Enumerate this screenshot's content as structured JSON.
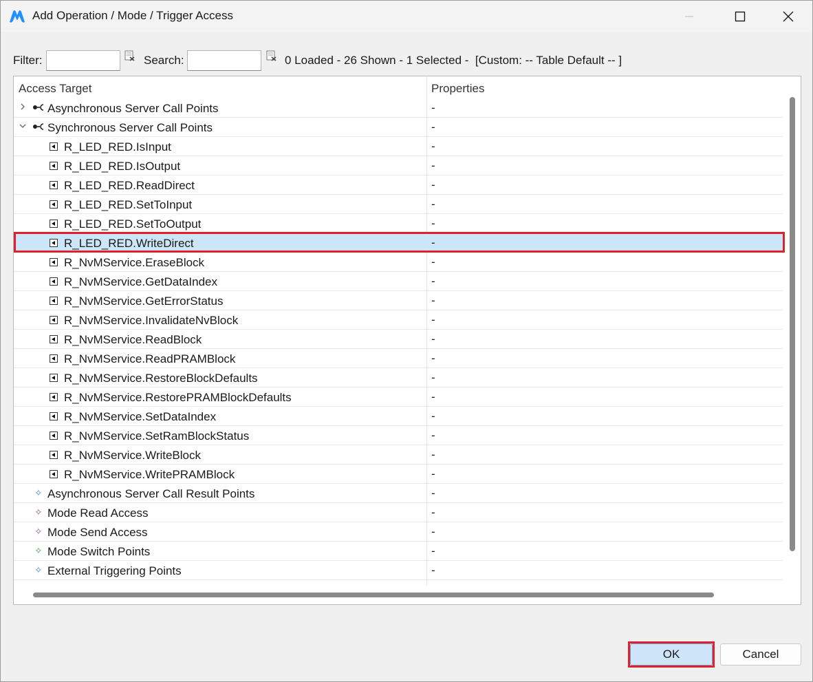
{
  "window": {
    "title": "Add Operation / Mode / Trigger Access"
  },
  "toolbar": {
    "filter_label": "Filter:",
    "filter_value": "",
    "search_label": "Search:",
    "search_value": "",
    "status": "0 Loaded - 26 Shown - 1 Selected -  [Custom: -- Table Default -- ]"
  },
  "table": {
    "columns": [
      "Access Target",
      "Properties"
    ],
    "rows": [
      {
        "label": "Asynchronous Server Call Points",
        "value": "-",
        "kind": "group",
        "expanded": false
      },
      {
        "label": "Synchronous Server Call Points",
        "value": "-",
        "kind": "group",
        "expanded": true
      },
      {
        "label": "R_LED_RED.IsInput",
        "value": "-",
        "kind": "op"
      },
      {
        "label": "R_LED_RED.IsOutput",
        "value": "-",
        "kind": "op"
      },
      {
        "label": "R_LED_RED.ReadDirect",
        "value": "-",
        "kind": "op"
      },
      {
        "label": "R_LED_RED.SetToInput",
        "value": "-",
        "kind": "op"
      },
      {
        "label": "R_LED_RED.SetToOutput",
        "value": "-",
        "kind": "op"
      },
      {
        "label": "R_LED_RED.WriteDirect",
        "value": "-",
        "kind": "op",
        "selected": true
      },
      {
        "label": "R_NvMService.EraseBlock",
        "value": "-",
        "kind": "op"
      },
      {
        "label": "R_NvMService.GetDataIndex",
        "value": "-",
        "kind": "op"
      },
      {
        "label": "R_NvMService.GetErrorStatus",
        "value": "-",
        "kind": "op"
      },
      {
        "label": "R_NvMService.InvalidateNvBlock",
        "value": "-",
        "kind": "op"
      },
      {
        "label": "R_NvMService.ReadBlock",
        "value": "-",
        "kind": "op"
      },
      {
        "label": "R_NvMService.ReadPRAMBlock",
        "value": "-",
        "kind": "op"
      },
      {
        "label": "R_NvMService.RestoreBlockDefaults",
        "value": "-",
        "kind": "op"
      },
      {
        "label": "R_NvMService.RestorePRAMBlockDefaults",
        "value": "-",
        "kind": "op"
      },
      {
        "label": "R_NvMService.SetDataIndex",
        "value": "-",
        "kind": "op"
      },
      {
        "label": "R_NvMService.SetRamBlockStatus",
        "value": "-",
        "kind": "op"
      },
      {
        "label": "R_NvMService.WriteBlock",
        "value": "-",
        "kind": "op"
      },
      {
        "label": "R_NvMService.WritePRAMBlock",
        "value": "-",
        "kind": "op"
      },
      {
        "label": "Asynchronous Server Call Result Points",
        "value": "-",
        "kind": "leaf",
        "icon_color": "#5a8fc8"
      },
      {
        "label": "Mode Read Access",
        "value": "-",
        "kind": "leaf",
        "icon_color": "#8a6a9a"
      },
      {
        "label": "Mode Send Access",
        "value": "-",
        "kind": "leaf",
        "icon_color": "#8a6a9a"
      },
      {
        "label": "Mode Switch Points",
        "value": "-",
        "kind": "leaf",
        "icon_color": "#5aa05a"
      },
      {
        "label": "External Triggering Points",
        "value": "-",
        "kind": "leaf",
        "icon_color": "#5a8fc8"
      }
    ]
  },
  "buttons": {
    "ok": "OK",
    "cancel": "Cancel"
  },
  "colors": {
    "accent": "#1e90ff",
    "selection": "#cde6f7",
    "highlight_outline": "#e0202a"
  }
}
